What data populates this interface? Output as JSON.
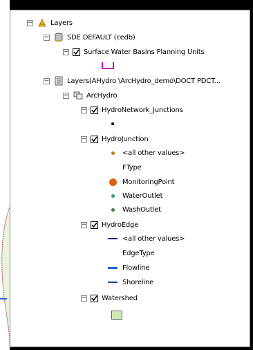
{
  "tree": {
    "root_label": "Layers",
    "frame1_label": "SDE DEFAULT (cedb)",
    "frame1_layer_label": "Surface Water Basins Planning Units",
    "frame2_label": "Layers(AHydro \\ArcHydro_demo\\DOCT PDCT...",
    "dataset_label": "ArcHydro",
    "hydronetwork_label": "HydroNetwork_Junctions",
    "hydrojunction_label": "HydroJunction",
    "hj_other_values": "<all other values>",
    "hj_ftype_header": "FType",
    "hj_item1": "MonitoringPoint",
    "hj_item2": "WaterOutlet",
    "hj_item3": "WashOutlet",
    "hydroedge_label": "HydroEdge",
    "he_other_values": "<all other values>",
    "he_edgetype_header": "EdgeType",
    "he_item1": "Flowline",
    "he_item2": "Shoreline",
    "watershed_label": "Watershed"
  },
  "colors": {
    "layers_icon": "#f0c000",
    "purple_swatch": "#c000c0",
    "monitoring_point": "#e06010",
    "water_outlet": "#20a080",
    "wash_outlet": "#408040",
    "other_junction": "#c08000",
    "edge_other": "#202080",
    "flowline": "#2060e0",
    "shoreline": "#2040a0",
    "watershed_fill": "#d0e8b8"
  }
}
